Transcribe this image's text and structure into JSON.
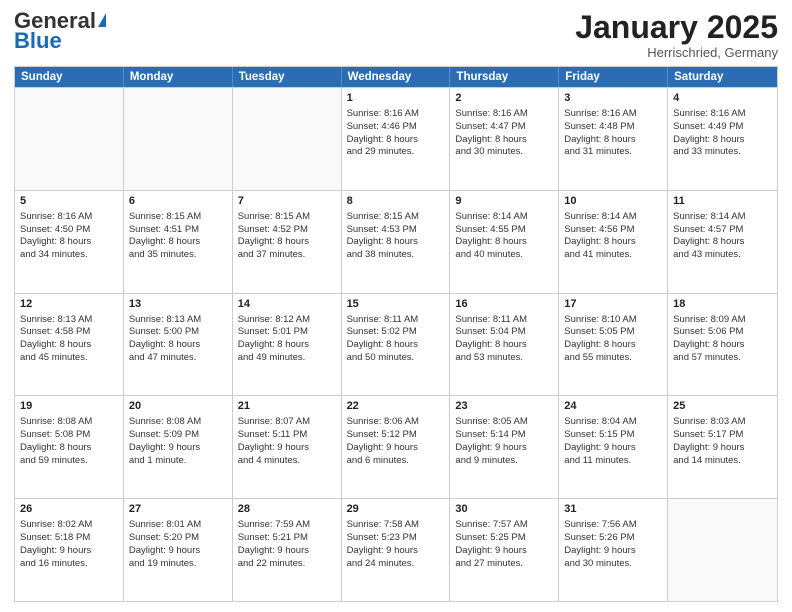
{
  "logo": {
    "general": "General",
    "blue": "Blue"
  },
  "header": {
    "month": "January 2025",
    "location": "Herrischried, Germany"
  },
  "days": [
    "Sunday",
    "Monday",
    "Tuesday",
    "Wednesday",
    "Thursday",
    "Friday",
    "Saturday"
  ],
  "rows": [
    [
      {
        "day": "",
        "content": ""
      },
      {
        "day": "",
        "content": ""
      },
      {
        "day": "",
        "content": ""
      },
      {
        "day": "1",
        "content": "Sunrise: 8:16 AM\nSunset: 4:46 PM\nDaylight: 8 hours\nand 29 minutes."
      },
      {
        "day": "2",
        "content": "Sunrise: 8:16 AM\nSunset: 4:47 PM\nDaylight: 8 hours\nand 30 minutes."
      },
      {
        "day": "3",
        "content": "Sunrise: 8:16 AM\nSunset: 4:48 PM\nDaylight: 8 hours\nand 31 minutes."
      },
      {
        "day": "4",
        "content": "Sunrise: 8:16 AM\nSunset: 4:49 PM\nDaylight: 8 hours\nand 33 minutes."
      }
    ],
    [
      {
        "day": "5",
        "content": "Sunrise: 8:16 AM\nSunset: 4:50 PM\nDaylight: 8 hours\nand 34 minutes."
      },
      {
        "day": "6",
        "content": "Sunrise: 8:15 AM\nSunset: 4:51 PM\nDaylight: 8 hours\nand 35 minutes."
      },
      {
        "day": "7",
        "content": "Sunrise: 8:15 AM\nSunset: 4:52 PM\nDaylight: 8 hours\nand 37 minutes."
      },
      {
        "day": "8",
        "content": "Sunrise: 8:15 AM\nSunset: 4:53 PM\nDaylight: 8 hours\nand 38 minutes."
      },
      {
        "day": "9",
        "content": "Sunrise: 8:14 AM\nSunset: 4:55 PM\nDaylight: 8 hours\nand 40 minutes."
      },
      {
        "day": "10",
        "content": "Sunrise: 8:14 AM\nSunset: 4:56 PM\nDaylight: 8 hours\nand 41 minutes."
      },
      {
        "day": "11",
        "content": "Sunrise: 8:14 AM\nSunset: 4:57 PM\nDaylight: 8 hours\nand 43 minutes."
      }
    ],
    [
      {
        "day": "12",
        "content": "Sunrise: 8:13 AM\nSunset: 4:58 PM\nDaylight: 8 hours\nand 45 minutes."
      },
      {
        "day": "13",
        "content": "Sunrise: 8:13 AM\nSunset: 5:00 PM\nDaylight: 8 hours\nand 47 minutes."
      },
      {
        "day": "14",
        "content": "Sunrise: 8:12 AM\nSunset: 5:01 PM\nDaylight: 8 hours\nand 49 minutes."
      },
      {
        "day": "15",
        "content": "Sunrise: 8:11 AM\nSunset: 5:02 PM\nDaylight: 8 hours\nand 50 minutes."
      },
      {
        "day": "16",
        "content": "Sunrise: 8:11 AM\nSunset: 5:04 PM\nDaylight: 8 hours\nand 53 minutes."
      },
      {
        "day": "17",
        "content": "Sunrise: 8:10 AM\nSunset: 5:05 PM\nDaylight: 8 hours\nand 55 minutes."
      },
      {
        "day": "18",
        "content": "Sunrise: 8:09 AM\nSunset: 5:06 PM\nDaylight: 8 hours\nand 57 minutes."
      }
    ],
    [
      {
        "day": "19",
        "content": "Sunrise: 8:08 AM\nSunset: 5:08 PM\nDaylight: 8 hours\nand 59 minutes."
      },
      {
        "day": "20",
        "content": "Sunrise: 8:08 AM\nSunset: 5:09 PM\nDaylight: 9 hours\nand 1 minute."
      },
      {
        "day": "21",
        "content": "Sunrise: 8:07 AM\nSunset: 5:11 PM\nDaylight: 9 hours\nand 4 minutes."
      },
      {
        "day": "22",
        "content": "Sunrise: 8:06 AM\nSunset: 5:12 PM\nDaylight: 9 hours\nand 6 minutes."
      },
      {
        "day": "23",
        "content": "Sunrise: 8:05 AM\nSunset: 5:14 PM\nDaylight: 9 hours\nand 9 minutes."
      },
      {
        "day": "24",
        "content": "Sunrise: 8:04 AM\nSunset: 5:15 PM\nDaylight: 9 hours\nand 11 minutes."
      },
      {
        "day": "25",
        "content": "Sunrise: 8:03 AM\nSunset: 5:17 PM\nDaylight: 9 hours\nand 14 minutes."
      }
    ],
    [
      {
        "day": "26",
        "content": "Sunrise: 8:02 AM\nSunset: 5:18 PM\nDaylight: 9 hours\nand 16 minutes."
      },
      {
        "day": "27",
        "content": "Sunrise: 8:01 AM\nSunset: 5:20 PM\nDaylight: 9 hours\nand 19 minutes."
      },
      {
        "day": "28",
        "content": "Sunrise: 7:59 AM\nSunset: 5:21 PM\nDaylight: 9 hours\nand 22 minutes."
      },
      {
        "day": "29",
        "content": "Sunrise: 7:58 AM\nSunset: 5:23 PM\nDaylight: 9 hours\nand 24 minutes."
      },
      {
        "day": "30",
        "content": "Sunrise: 7:57 AM\nSunset: 5:25 PM\nDaylight: 9 hours\nand 27 minutes."
      },
      {
        "day": "31",
        "content": "Sunrise: 7:56 AM\nSunset: 5:26 PM\nDaylight: 9 hours\nand 30 minutes."
      },
      {
        "day": "",
        "content": ""
      }
    ]
  ]
}
